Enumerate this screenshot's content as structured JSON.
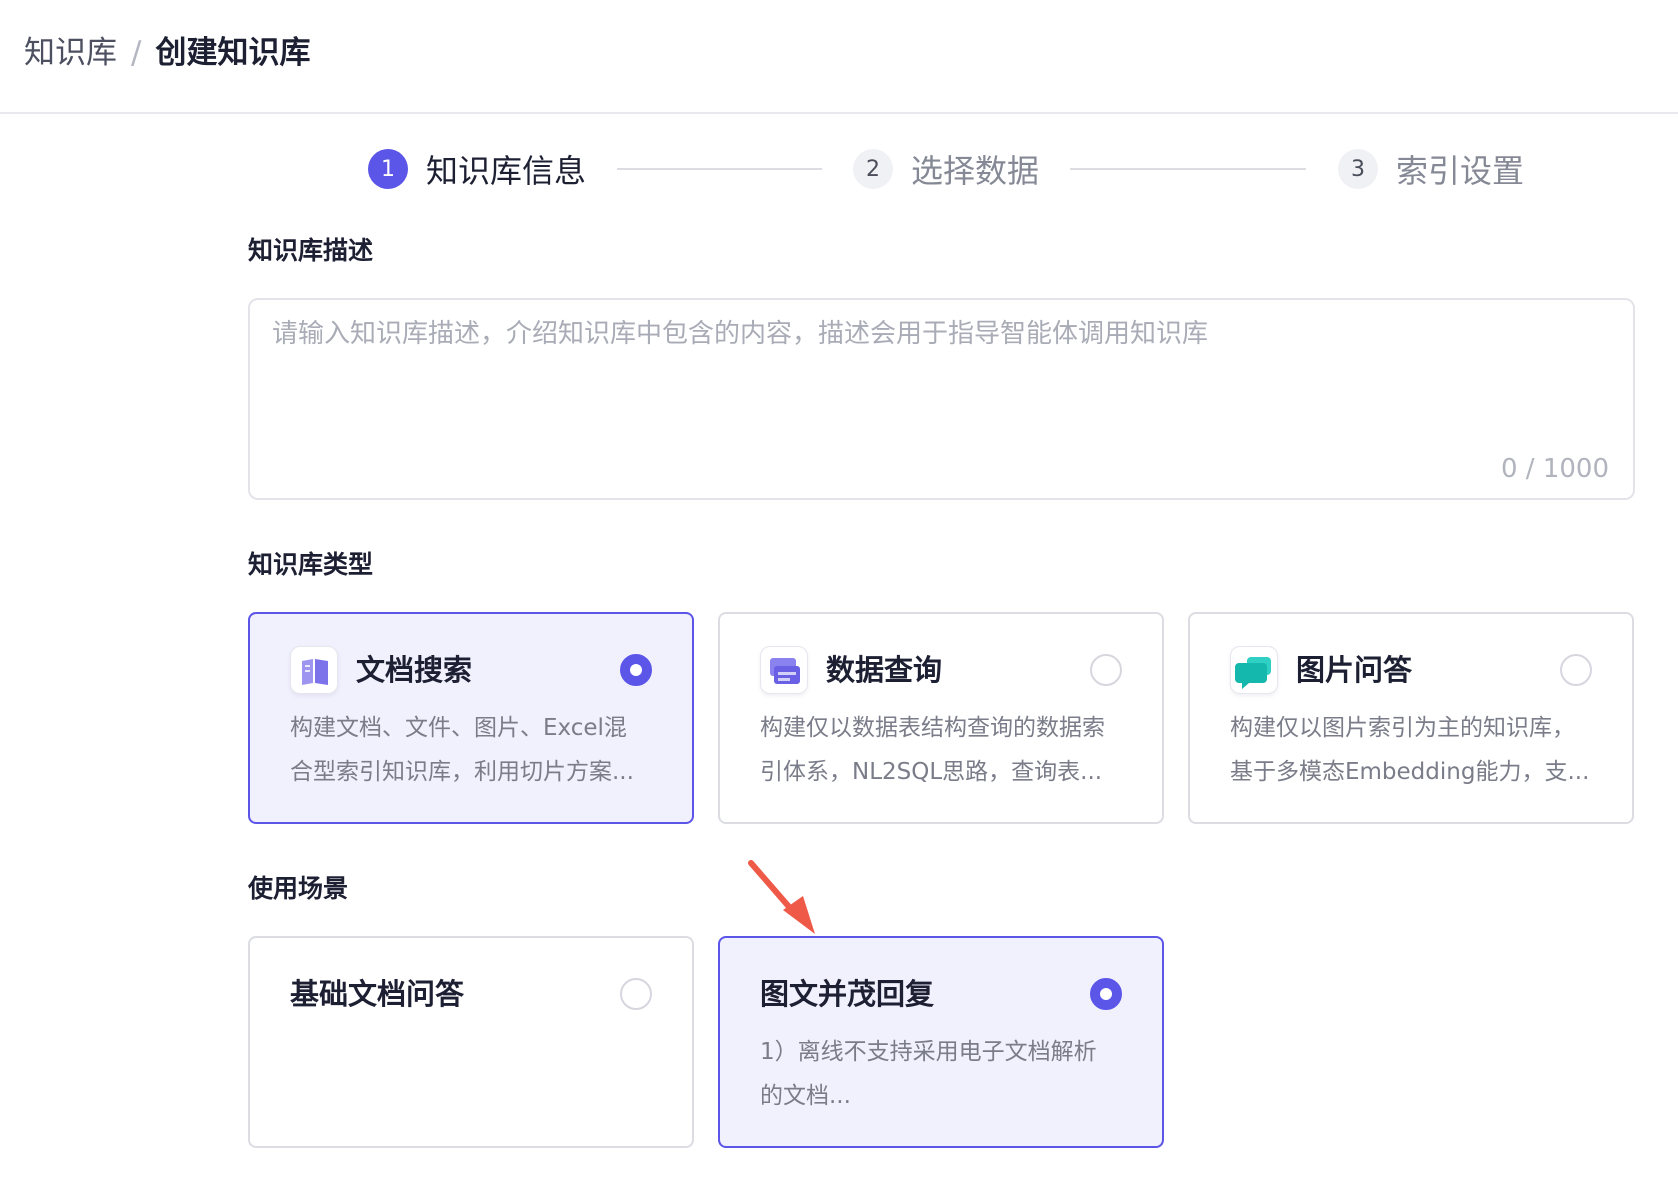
{
  "breadcrumb": {
    "parent": "知识库",
    "separator": "/",
    "current": "创建知识库"
  },
  "steps": [
    {
      "number": "1",
      "label": "知识库信息",
      "state": "active"
    },
    {
      "number": "2",
      "label": "选择数据",
      "state": "inactive"
    },
    {
      "number": "3",
      "label": "索引设置",
      "state": "inactive"
    }
  ],
  "description": {
    "label": "知识库描述",
    "value": "",
    "placeholder": "请输入知识库描述，介绍知识库中包含的内容，描述会用于指导智能体调用知识库",
    "counter": "0 / 1000"
  },
  "kb_type": {
    "label": "知识库类型",
    "options": [
      {
        "title": "文档搜索",
        "desc_line1": "构建文档、文件、图片、Excel混",
        "desc_line2": "合型索引知识库，利用切片方案...",
        "selected": true,
        "icon": "book-icon"
      },
      {
        "title": "数据查询",
        "desc_line1": "构建仅以数据表结构查询的数据索",
        "desc_line2": "引体系，NL2SQL思路，查询表...",
        "selected": false,
        "icon": "data-table-icon"
      },
      {
        "title": "图片问答",
        "desc_line1": "构建仅以图片索引为主的知识库，",
        "desc_line2": "基于多模态Embedding能力，支...",
        "selected": false,
        "icon": "chat-bubble-icon"
      }
    ]
  },
  "scenario": {
    "label": "使用场景",
    "options": [
      {
        "title": "基础文档问答",
        "desc_line1": "",
        "desc_line2": "",
        "selected": false
      },
      {
        "title": "图文并茂回复",
        "desc_line1": "1）离线不支持采用电子文档解析",
        "desc_line2": "的文档...",
        "selected": true
      }
    ]
  },
  "colors": {
    "accent": "#5b55e8",
    "selected_bg": "#f1f0fd",
    "annotation_arrow": "#ee5a47"
  }
}
